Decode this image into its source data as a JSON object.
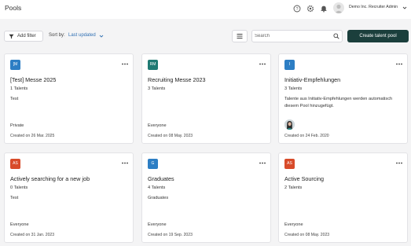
{
  "header": {
    "title": "Pools",
    "user_name": "Demo Inc. Recruiter Admin",
    "icons": [
      "help-icon",
      "gear-icon",
      "bell-icon",
      "user-avatar",
      "chevron-down-icon"
    ]
  },
  "toolbar": {
    "add_filter_label": "Add filter",
    "sort_label": "Sort by:",
    "sort_value": "Last updated",
    "search_placeholder": "Search",
    "create_label": "Create talent pool"
  },
  "colors": {
    "primary_button": "#1b3f3c",
    "sort_link": "#2f6fb3",
    "badge_blue": "#2d7ec4",
    "badge_teal": "#1f7a73",
    "badge_orange": "#d84b2a"
  },
  "pools": [
    {
      "initials": "[M",
      "badge_color": "#2d7ec4",
      "title": "[Test] Messe 2025",
      "count": "1 Talents",
      "description": "Test",
      "visibility": "Private",
      "created": "Created on 26 Mar. 2025"
    },
    {
      "initials": "RM",
      "badge_color": "#1f7a73",
      "title": "Recruiting Messe 2023",
      "count": "3 Talents",
      "description": "",
      "visibility": "Everyone",
      "created": "Created on 08 May. 2023"
    },
    {
      "initials": "I",
      "badge_color": "#2d7ec4",
      "title": "Initiativ-Empfehlungen",
      "count": "3 Talents",
      "description": "Talente aus Initiativ-Empfehlungen werden automatisch diesem Pool hinzugefügt.",
      "visibility": "",
      "created": "Created on 24 Feb. 2020"
    },
    {
      "initials": "AS",
      "badge_color": "#d84b2a",
      "title": "Actively searching for a new job",
      "count": "0 Talents",
      "description": "Test",
      "visibility": "Everyone",
      "created": "Created on 31 Jan. 2023"
    },
    {
      "initials": "G",
      "badge_color": "#2d7ec4",
      "title": "Graduates",
      "count": "4 Talents",
      "description": "Graduates",
      "visibility": "Everyone",
      "created": "Created on 19 Sep. 2023"
    },
    {
      "initials": "AS",
      "badge_color": "#d84b2a",
      "title": "Active Sourcing",
      "count": "2 Talents",
      "description": "",
      "visibility": "Everyone",
      "created": "Created on 08 May. 2023"
    }
  ]
}
